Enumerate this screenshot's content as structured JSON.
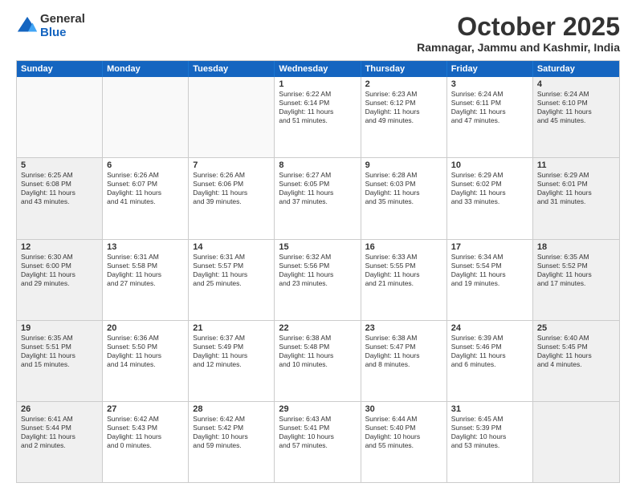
{
  "header": {
    "logo_line1": "General",
    "logo_line2": "Blue",
    "month_title": "October 2025",
    "subtitle": "Ramnagar, Jammu and Kashmir, India"
  },
  "weekdays": [
    "Sunday",
    "Monday",
    "Tuesday",
    "Wednesday",
    "Thursday",
    "Friday",
    "Saturday"
  ],
  "rows": [
    [
      {
        "day": "",
        "lines": [],
        "empty": true
      },
      {
        "day": "",
        "lines": [],
        "empty": true
      },
      {
        "day": "",
        "lines": [],
        "empty": true
      },
      {
        "day": "1",
        "lines": [
          "Sunrise: 6:22 AM",
          "Sunset: 6:14 PM",
          "Daylight: 11 hours",
          "and 51 minutes."
        ]
      },
      {
        "day": "2",
        "lines": [
          "Sunrise: 6:23 AM",
          "Sunset: 6:12 PM",
          "Daylight: 11 hours",
          "and 49 minutes."
        ]
      },
      {
        "day": "3",
        "lines": [
          "Sunrise: 6:24 AM",
          "Sunset: 6:11 PM",
          "Daylight: 11 hours",
          "and 47 minutes."
        ]
      },
      {
        "day": "4",
        "lines": [
          "Sunrise: 6:24 AM",
          "Sunset: 6:10 PM",
          "Daylight: 11 hours",
          "and 45 minutes."
        ],
        "shaded": true
      }
    ],
    [
      {
        "day": "5",
        "lines": [
          "Sunrise: 6:25 AM",
          "Sunset: 6:08 PM",
          "Daylight: 11 hours",
          "and 43 minutes."
        ],
        "shaded": true
      },
      {
        "day": "6",
        "lines": [
          "Sunrise: 6:26 AM",
          "Sunset: 6:07 PM",
          "Daylight: 11 hours",
          "and 41 minutes."
        ]
      },
      {
        "day": "7",
        "lines": [
          "Sunrise: 6:26 AM",
          "Sunset: 6:06 PM",
          "Daylight: 11 hours",
          "and 39 minutes."
        ]
      },
      {
        "day": "8",
        "lines": [
          "Sunrise: 6:27 AM",
          "Sunset: 6:05 PM",
          "Daylight: 11 hours",
          "and 37 minutes."
        ]
      },
      {
        "day": "9",
        "lines": [
          "Sunrise: 6:28 AM",
          "Sunset: 6:03 PM",
          "Daylight: 11 hours",
          "and 35 minutes."
        ]
      },
      {
        "day": "10",
        "lines": [
          "Sunrise: 6:29 AM",
          "Sunset: 6:02 PM",
          "Daylight: 11 hours",
          "and 33 minutes."
        ]
      },
      {
        "day": "11",
        "lines": [
          "Sunrise: 6:29 AM",
          "Sunset: 6:01 PM",
          "Daylight: 11 hours",
          "and 31 minutes."
        ],
        "shaded": true
      }
    ],
    [
      {
        "day": "12",
        "lines": [
          "Sunrise: 6:30 AM",
          "Sunset: 6:00 PM",
          "Daylight: 11 hours",
          "and 29 minutes."
        ],
        "shaded": true
      },
      {
        "day": "13",
        "lines": [
          "Sunrise: 6:31 AM",
          "Sunset: 5:58 PM",
          "Daylight: 11 hours",
          "and 27 minutes."
        ]
      },
      {
        "day": "14",
        "lines": [
          "Sunrise: 6:31 AM",
          "Sunset: 5:57 PM",
          "Daylight: 11 hours",
          "and 25 minutes."
        ]
      },
      {
        "day": "15",
        "lines": [
          "Sunrise: 6:32 AM",
          "Sunset: 5:56 PM",
          "Daylight: 11 hours",
          "and 23 minutes."
        ]
      },
      {
        "day": "16",
        "lines": [
          "Sunrise: 6:33 AM",
          "Sunset: 5:55 PM",
          "Daylight: 11 hours",
          "and 21 minutes."
        ]
      },
      {
        "day": "17",
        "lines": [
          "Sunrise: 6:34 AM",
          "Sunset: 5:54 PM",
          "Daylight: 11 hours",
          "and 19 minutes."
        ]
      },
      {
        "day": "18",
        "lines": [
          "Sunrise: 6:35 AM",
          "Sunset: 5:52 PM",
          "Daylight: 11 hours",
          "and 17 minutes."
        ],
        "shaded": true
      }
    ],
    [
      {
        "day": "19",
        "lines": [
          "Sunrise: 6:35 AM",
          "Sunset: 5:51 PM",
          "Daylight: 11 hours",
          "and 15 minutes."
        ],
        "shaded": true
      },
      {
        "day": "20",
        "lines": [
          "Sunrise: 6:36 AM",
          "Sunset: 5:50 PM",
          "Daylight: 11 hours",
          "and 14 minutes."
        ]
      },
      {
        "day": "21",
        "lines": [
          "Sunrise: 6:37 AM",
          "Sunset: 5:49 PM",
          "Daylight: 11 hours",
          "and 12 minutes."
        ]
      },
      {
        "day": "22",
        "lines": [
          "Sunrise: 6:38 AM",
          "Sunset: 5:48 PM",
          "Daylight: 11 hours",
          "and 10 minutes."
        ]
      },
      {
        "day": "23",
        "lines": [
          "Sunrise: 6:38 AM",
          "Sunset: 5:47 PM",
          "Daylight: 11 hours",
          "and 8 minutes."
        ]
      },
      {
        "day": "24",
        "lines": [
          "Sunrise: 6:39 AM",
          "Sunset: 5:46 PM",
          "Daylight: 11 hours",
          "and 6 minutes."
        ]
      },
      {
        "day": "25",
        "lines": [
          "Sunrise: 6:40 AM",
          "Sunset: 5:45 PM",
          "Daylight: 11 hours",
          "and 4 minutes."
        ],
        "shaded": true
      }
    ],
    [
      {
        "day": "26",
        "lines": [
          "Sunrise: 6:41 AM",
          "Sunset: 5:44 PM",
          "Daylight: 11 hours",
          "and 2 minutes."
        ],
        "shaded": true
      },
      {
        "day": "27",
        "lines": [
          "Sunrise: 6:42 AM",
          "Sunset: 5:43 PM",
          "Daylight: 11 hours",
          "and 0 minutes."
        ]
      },
      {
        "day": "28",
        "lines": [
          "Sunrise: 6:42 AM",
          "Sunset: 5:42 PM",
          "Daylight: 10 hours",
          "and 59 minutes."
        ]
      },
      {
        "day": "29",
        "lines": [
          "Sunrise: 6:43 AM",
          "Sunset: 5:41 PM",
          "Daylight: 10 hours",
          "and 57 minutes."
        ]
      },
      {
        "day": "30",
        "lines": [
          "Sunrise: 6:44 AM",
          "Sunset: 5:40 PM",
          "Daylight: 10 hours",
          "and 55 minutes."
        ]
      },
      {
        "day": "31",
        "lines": [
          "Sunrise: 6:45 AM",
          "Sunset: 5:39 PM",
          "Daylight: 10 hours",
          "and 53 minutes."
        ]
      },
      {
        "day": "",
        "lines": [],
        "empty": true,
        "shaded": true
      }
    ]
  ]
}
